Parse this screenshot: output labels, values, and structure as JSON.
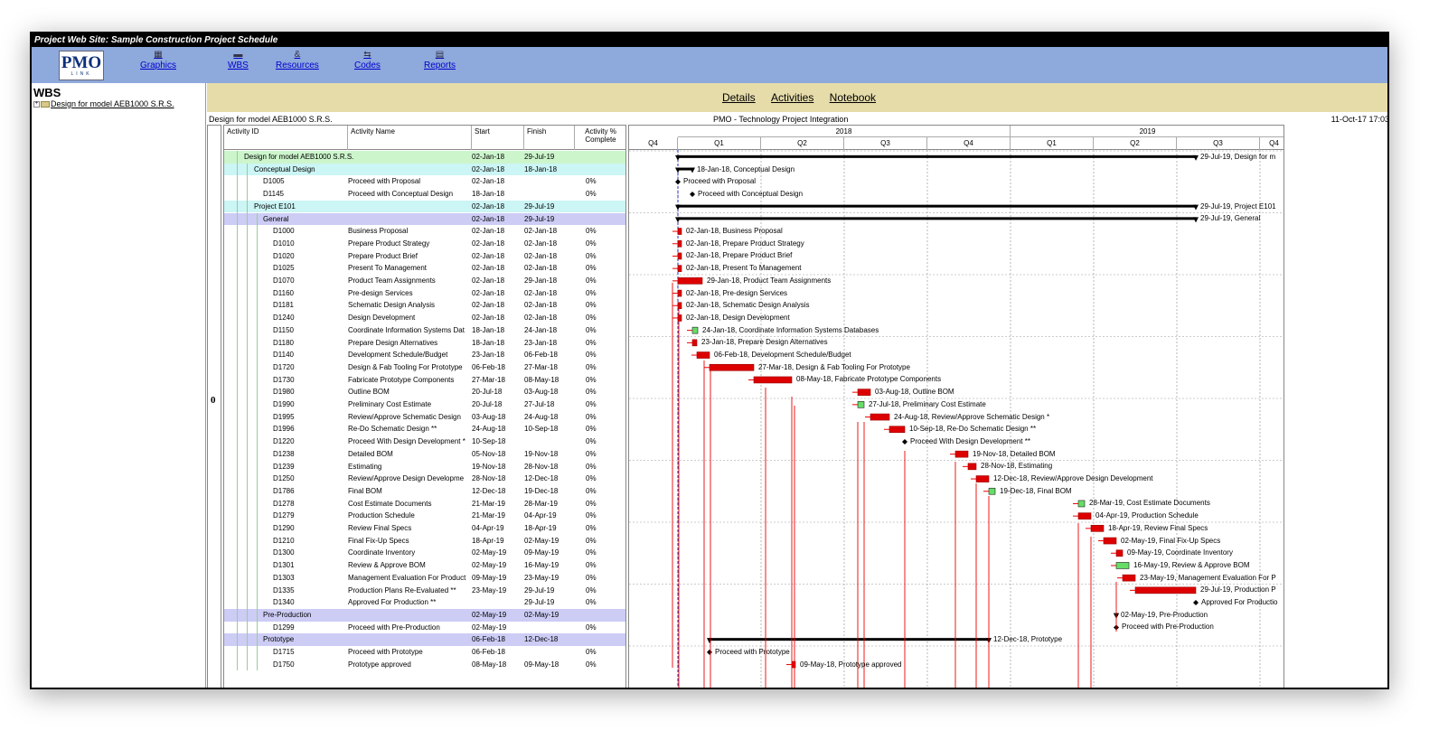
{
  "window_title": "Project Web Site: Sample Construction Project Schedule",
  "logo": {
    "main": "PMO",
    "sub": "LINK"
  },
  "nav": [
    {
      "label": "Graphics",
      "icon": "graphics-icon",
      "glyph": "▦"
    },
    {
      "label": "WBS",
      "icon": "wbs-icon",
      "glyph": "▬"
    },
    {
      "label": "Resources",
      "icon": "resources-icon",
      "glyph": "&"
    },
    {
      "label": "Codes",
      "icon": "codes-icon",
      "glyph": "⇆"
    },
    {
      "label": "Reports",
      "icon": "reports-icon",
      "glyph": "▤"
    }
  ],
  "wbs": {
    "heading": "WBS",
    "node": "Design for model AEB1000 S.R.S."
  },
  "tabs": [
    "Details",
    "Activities",
    "Notebook"
  ],
  "info": {
    "left": "Design for model AEB1000 S.R.S.",
    "center": "PMO - Technology Project Integration",
    "right": "11-Oct-17 17:03"
  },
  "index_label": "0",
  "columns": [
    "Activity ID",
    "Activity Name",
    "Start",
    "Finish",
    "Activity % Complete"
  ],
  "timescale": {
    "years": [
      "2018",
      "2019"
    ],
    "quarters": [
      "Q4",
      "Q1",
      "Q2",
      "Q3",
      "Q4",
      "Q1",
      "Q2",
      "Q3",
      "Q4"
    ]
  },
  "colors": {
    "summary1": "#ccf5cc",
    "summary2": "#ccf5f5",
    "summary3": "#ccccf5",
    "bar": "#dd0000",
    "milestone_green": "#66dd66",
    "link": "#ee0000"
  },
  "rows": [
    {
      "id": "Design for model AEB1000 S.R.S.",
      "name": "",
      "start": "02-Jan-18",
      "finish": "29-Jul-19",
      "pct": "",
      "level": 1,
      "type": "summary",
      "label": "29-Jul-19, Design for m",
      "s": 0,
      "f": 573
    },
    {
      "id": "Conceptual Design",
      "name": "",
      "start": "02-Jan-18",
      "finish": "18-Jan-18",
      "pct": "",
      "level": 2,
      "type": "summary",
      "label": "18-Jan-18, Conceptual Design",
      "s": 0,
      "f": 16
    },
    {
      "id": "D1005",
      "name": "Proceed with Proposal",
      "start": "02-Jan-18",
      "finish": "",
      "pct": "0%",
      "level": 3,
      "type": "mile",
      "label": "Proceed with Proposal",
      "s": 0,
      "f": 0
    },
    {
      "id": "D1145",
      "name": "Proceed with Conceptual Design",
      "start": "18-Jan-18",
      "finish": "",
      "pct": "0%",
      "level": 3,
      "type": "mile",
      "label": "Proceed with Conceptual Design",
      "s": 16,
      "f": 16
    },
    {
      "id": "Project E101",
      "name": "",
      "start": "02-Jan-18",
      "finish": "29-Jul-19",
      "pct": "",
      "level": 2,
      "type": "summary",
      "label": "29-Jul-19, Project E101",
      "s": 0,
      "f": 573
    },
    {
      "id": "General",
      "name": "",
      "start": "02-Jan-18",
      "finish": "29-Jul-19",
      "pct": "",
      "level": 3,
      "type": "summary",
      "label": "29-Jul-19, General",
      "s": 0,
      "f": 573
    },
    {
      "id": "D1000",
      "name": "Business Proposal",
      "start": "02-Jan-18",
      "finish": "02-Jan-18",
      "pct": "0%",
      "level": 4,
      "type": "task",
      "label": "02-Jan-18, Business Proposal",
      "s": 0,
      "f": 0
    },
    {
      "id": "D1010",
      "name": "Prepare Product Strategy",
      "start": "02-Jan-18",
      "finish": "02-Jan-18",
      "pct": "0%",
      "level": 4,
      "type": "task",
      "label": "02-Jan-18, Prepare Product Strategy",
      "s": 0,
      "f": 0
    },
    {
      "id": "D1020",
      "name": "Prepare Product Brief",
      "start": "02-Jan-18",
      "finish": "02-Jan-18",
      "pct": "0%",
      "level": 4,
      "type": "task",
      "label": "02-Jan-18, Prepare Product Brief",
      "s": 0,
      "f": 0
    },
    {
      "id": "D1025",
      "name": "Present To Management",
      "start": "02-Jan-18",
      "finish": "02-Jan-18",
      "pct": "0%",
      "level": 4,
      "type": "task",
      "label": "02-Jan-18, Present To Management",
      "s": 0,
      "f": 0
    },
    {
      "id": "D1070",
      "name": "Product Team Assignments",
      "start": "02-Jan-18",
      "finish": "29-Jan-18",
      "pct": "0%",
      "level": 4,
      "type": "task",
      "label": "29-Jan-18, Product Team Assignments",
      "s": 0,
      "f": 27
    },
    {
      "id": "D1160",
      "name": "Pre-design Services",
      "start": "02-Jan-18",
      "finish": "02-Jan-18",
      "pct": "0%",
      "level": 4,
      "type": "task",
      "label": "02-Jan-18, Pre-design Services",
      "s": 0,
      "f": 0
    },
    {
      "id": "D1181",
      "name": "Schematic Design Analysis",
      "start": "02-Jan-18",
      "finish": "02-Jan-18",
      "pct": "0%",
      "level": 4,
      "type": "task",
      "label": "02-Jan-18, Schematic Design Analysis",
      "s": 0,
      "f": 0
    },
    {
      "id": "D1240",
      "name": "Design Development",
      "start": "02-Jan-18",
      "finish": "02-Jan-18",
      "pct": "0%",
      "level": 4,
      "type": "task",
      "label": "02-Jan-18, Design Development",
      "s": 0,
      "f": 0
    },
    {
      "id": "D1150",
      "name": "Coordinate Information Systems Dat",
      "start": "18-Jan-18",
      "finish": "24-Jan-18",
      "pct": "0%",
      "level": 4,
      "type": "green",
      "label": "24-Jan-18, Coordinate Information Systems Databases",
      "s": 16,
      "f": 22
    },
    {
      "id": "D1180",
      "name": "Prepare Design Alternatives",
      "start": "18-Jan-18",
      "finish": "23-Jan-18",
      "pct": "0%",
      "level": 4,
      "type": "task",
      "label": "23-Jan-18, Prepare Design Alternatives",
      "s": 16,
      "f": 21
    },
    {
      "id": "D1140",
      "name": "Development Schedule/Budget",
      "start": "23-Jan-18",
      "finish": "06-Feb-18",
      "pct": "0%",
      "level": 4,
      "type": "task",
      "label": "06-Feb-18, Development Schedule/Budget",
      "s": 21,
      "f": 35
    },
    {
      "id": "D1720",
      "name": "Design & Fab Tooling For Prototype",
      "start": "06-Feb-18",
      "finish": "27-Mar-18",
      "pct": "0%",
      "level": 4,
      "type": "task",
      "label": "27-Mar-18, Design & Fab Tooling For Prototype",
      "s": 35,
      "f": 84
    },
    {
      "id": "D1730",
      "name": "Fabricate Prototype Components",
      "start": "27-Mar-18",
      "finish": "08-May-18",
      "pct": "0%",
      "level": 4,
      "type": "task",
      "label": "08-May-18, Fabricate Prototype Components",
      "s": 84,
      "f": 126
    },
    {
      "id": "D1980",
      "name": "Outline BOM",
      "start": "20-Jul-18",
      "finish": "03-Aug-18",
      "pct": "0%",
      "level": 4,
      "type": "task",
      "label": "03-Aug-18, Outline BOM",
      "s": 199,
      "f": 213
    },
    {
      "id": "D1990",
      "name": "Preliminary Cost Estimate",
      "start": "20-Jul-18",
      "finish": "27-Jul-18",
      "pct": "0%",
      "level": 4,
      "type": "green",
      "label": "27-Jul-18, Preliminary Cost Estimate",
      "s": 199,
      "f": 206
    },
    {
      "id": "D1995",
      "name": "Review/Approve Schematic Design",
      "start": "03-Aug-18",
      "finish": "24-Aug-18",
      "pct": "0%",
      "level": 4,
      "type": "task",
      "label": "24-Aug-18, Review/Approve Schematic Design *",
      "s": 213,
      "f": 234
    },
    {
      "id": "D1996",
      "name": "Re-Do Schematic Design **",
      "start": "24-Aug-18",
      "finish": "10-Sep-18",
      "pct": "0%",
      "level": 4,
      "type": "task",
      "label": "10-Sep-18, Re-Do Schematic Design **",
      "s": 234,
      "f": 251
    },
    {
      "id": "D1220",
      "name": "Proceed With Design Development *",
      "start": "10-Sep-18",
      "finish": "",
      "pct": "0%",
      "level": 4,
      "type": "mile",
      "label": "Proceed With Design Development **",
      "s": 251,
      "f": 251
    },
    {
      "id": "D1238",
      "name": "Detailed BOM",
      "start": "05-Nov-18",
      "finish": "19-Nov-18",
      "pct": "0%",
      "level": 4,
      "type": "task",
      "label": "19-Nov-18, Detailed BOM",
      "s": 307,
      "f": 321
    },
    {
      "id": "D1239",
      "name": "Estimating",
      "start": "19-Nov-18",
      "finish": "28-Nov-18",
      "pct": "0%",
      "level": 4,
      "type": "task",
      "label": "28-Nov-18, Estimating",
      "s": 321,
      "f": 330
    },
    {
      "id": "D1250",
      "name": "Review/Approve Design Developme",
      "start": "28-Nov-18",
      "finish": "12-Dec-18",
      "pct": "0%",
      "level": 4,
      "type": "task",
      "label": "12-Dec-18, Review/Approve Design Development",
      "s": 330,
      "f": 344
    },
    {
      "id": "D1786",
      "name": "Final BOM",
      "start": "12-Dec-18",
      "finish": "19-Dec-18",
      "pct": "0%",
      "level": 4,
      "type": "green",
      "label": "19-Dec-18, Final BOM",
      "s": 344,
      "f": 351
    },
    {
      "id": "D1278",
      "name": "Cost Estimate Documents",
      "start": "21-Mar-19",
      "finish": "28-Mar-19",
      "pct": "0%",
      "level": 4,
      "type": "green",
      "label": "28-Mar-19, Cost Estimate Documents",
      "s": 443,
      "f": 450
    },
    {
      "id": "D1279",
      "name": "Production Schedule",
      "start": "21-Mar-19",
      "finish": "04-Apr-19",
      "pct": "0%",
      "level": 4,
      "type": "task",
      "label": "04-Apr-19, Production Schedule",
      "s": 443,
      "f": 457
    },
    {
      "id": "D1290",
      "name": "Review Final Specs",
      "start": "04-Apr-19",
      "finish": "18-Apr-19",
      "pct": "0%",
      "level": 4,
      "type": "task",
      "label": "18-Apr-19, Review Final Specs",
      "s": 457,
      "f": 471
    },
    {
      "id": "D1210",
      "name": "Final Fix-Up Specs",
      "start": "18-Apr-19",
      "finish": "02-May-19",
      "pct": "0%",
      "level": 4,
      "type": "task",
      "label": "02-May-19, Final Fix-Up Specs",
      "s": 471,
      "f": 485
    },
    {
      "id": "D1300",
      "name": "Coordinate Inventory",
      "start": "02-May-19",
      "finish": "09-May-19",
      "pct": "0%",
      "level": 4,
      "type": "task",
      "label": "09-May-19, Coordinate Inventory",
      "s": 485,
      "f": 492
    },
    {
      "id": "D1301",
      "name": "Review & Approve BOM",
      "start": "02-May-19",
      "finish": "16-May-19",
      "pct": "0%",
      "level": 4,
      "type": "green",
      "label": "16-May-19, Review & Approve BOM",
      "s": 485,
      "f": 499
    },
    {
      "id": "D1303",
      "name": "Management Evaluation For Product",
      "start": "09-May-19",
      "finish": "23-May-19",
      "pct": "0%",
      "level": 4,
      "type": "task",
      "label": "23-May-19, Management Evaluation For P",
      "s": 492,
      "f": 506
    },
    {
      "id": "D1335",
      "name": "Production Plans Re-Evaluated **",
      "start": "23-May-19",
      "finish": "29-Jul-19",
      "pct": "0%",
      "level": 4,
      "type": "task",
      "label": "29-Jul-19, Production P",
      "s": 506,
      "f": 573
    },
    {
      "id": "D1340",
      "name": "Approved For Production **",
      "start": "",
      "finish": "29-Jul-19",
      "pct": "0%",
      "level": 4,
      "type": "mile",
      "label": "Approved For Productio",
      "s": 573,
      "f": 573
    },
    {
      "id": "Pre-Production",
      "name": "",
      "start": "02-May-19",
      "finish": "02-May-19",
      "pct": "",
      "level": 3,
      "type": "summary",
      "label": "02-May-19, Pre-Production",
      "s": 485,
      "f": 485
    },
    {
      "id": "D1299",
      "name": "Proceed with Pre-Production",
      "start": "02-May-19",
      "finish": "",
      "pct": "0%",
      "level": 4,
      "type": "mile",
      "label": "Proceed with Pre-Production",
      "s": 485,
      "f": 485
    },
    {
      "id": "Prototype",
      "name": "",
      "start": "06-Feb-18",
      "finish": "12-Dec-18",
      "pct": "",
      "level": 3,
      "type": "summary",
      "label": "12-Dec-18, Prototype",
      "s": 35,
      "f": 344
    },
    {
      "id": "D1715",
      "name": "Proceed with Prototype",
      "start": "06-Feb-18",
      "finish": "",
      "pct": "0%",
      "level": 4,
      "type": "mile",
      "label": "Proceed with Prototype",
      "s": 35,
      "f": 35
    },
    {
      "id": "D1750",
      "name": "Prototype approved",
      "start": "08-May-18",
      "finish": "09-May-18",
      "pct": "0%",
      "level": 4,
      "type": "task",
      "label": "09-May-18, Prototype approved",
      "s": 126,
      "f": 127
    }
  ]
}
